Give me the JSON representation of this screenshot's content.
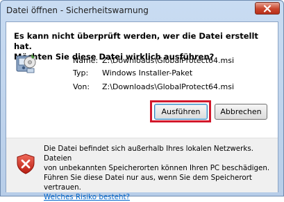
{
  "window": {
    "title": "Datei öffnen - Sicherheitswarnung"
  },
  "dialog": {
    "heading_line1": "Es kann nicht überprüft werden, wer die Datei erstellt hat.",
    "heading_line2": "Möchten Sie diese Datei wirklich ausführen?",
    "fields": [
      {
        "label": "Name:",
        "value": "Z:\\Downloads\\GlobalProtect64.msi"
      },
      {
        "label": "Typ:",
        "value": "Windows Installer-Paket"
      },
      {
        "label": "Von:",
        "value": "Z:\\Downloads\\GlobalProtect64.msi"
      }
    ],
    "run_label": "Ausführen",
    "cancel_label": "Abbrechen"
  },
  "footer": {
    "line1": "Die Datei befindet sich außerhalb Ihres lokalen Netzwerks. Dateien",
    "line2": "von unbekannten Speicherorten können Ihren PC beschädigen.",
    "line3": "Führen Sie diese Datei nur aus, wenn Sie dem Speicherort vertrauen.",
    "link": "Welches Risiko besteht?"
  },
  "icons": {
    "installer": "installer-package-icon",
    "warning": "security-shield-icon",
    "close": "close-icon"
  },
  "colors": {
    "highlight": "#d2182b",
    "link": "#0066cc"
  }
}
